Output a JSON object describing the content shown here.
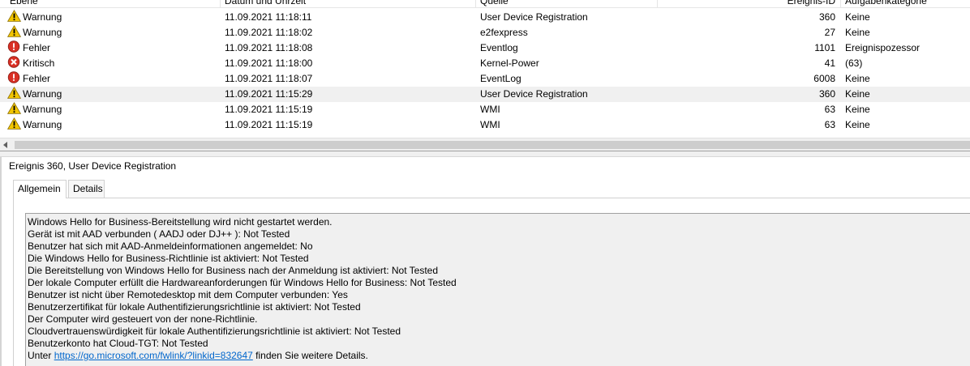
{
  "columns": {
    "level": "Ebene",
    "datetime": "Datum und Uhrzeit",
    "source": "Quelle",
    "event_id": "Ereignis-ID",
    "category": "Aufgabenkategorie"
  },
  "events": [
    {
      "level": "Warnung",
      "icon": "warning-icon",
      "datetime": "11.09.2021 11:18:11",
      "source": "User Device Registration",
      "event_id": "360",
      "category": "Keine"
    },
    {
      "level": "Warnung",
      "icon": "warning-icon",
      "datetime": "11.09.2021 11:18:02",
      "source": "e2fexpress",
      "event_id": "27",
      "category": "Keine"
    },
    {
      "level": "Fehler",
      "icon": "error-icon",
      "datetime": "11.09.2021 11:18:08",
      "source": "Eventlog",
      "event_id": "1101",
      "category": "Ereignispozessor"
    },
    {
      "level": "Kritisch",
      "icon": "critical-icon",
      "datetime": "11.09.2021 11:18:00",
      "source": "Kernel-Power",
      "event_id": "41",
      "category": "(63)"
    },
    {
      "level": "Fehler",
      "icon": "error-icon",
      "datetime": "11.09.2021 11:18:07",
      "source": "EventLog",
      "event_id": "6008",
      "category": "Keine"
    },
    {
      "level": "Warnung",
      "icon": "warning-icon",
      "datetime": "11.09.2021 11:15:29",
      "source": "User Device Registration",
      "event_id": "360",
      "category": "Keine",
      "selected": true
    },
    {
      "level": "Warnung",
      "icon": "warning-icon",
      "datetime": "11.09.2021 11:15:19",
      "source": "WMI",
      "event_id": "63",
      "category": "Keine"
    },
    {
      "level": "Warnung",
      "icon": "warning-icon",
      "datetime": "11.09.2021 11:15:19",
      "source": "WMI",
      "event_id": "63",
      "category": "Keine"
    }
  ],
  "detail": {
    "title": "Ereignis 360, User Device Registration",
    "tabs": [
      "Allgemein",
      "Details"
    ],
    "lines": [
      "Windows Hello for Business-Bereitstellung wird nicht gestartet werden.",
      "Gerät ist mit AAD verbunden ( AADJ oder DJ++ ): Not Tested",
      "Benutzer hat sich mit AAD-Anmeldeinformationen angemeldet: No",
      "Die Windows Hello for Business-Richtlinie ist aktiviert: Not Tested",
      "Die Bereitstellung von Windows Hello for Business nach der Anmeldung ist aktiviert: Not Tested",
      "Der lokale Computer erfüllt die Hardwareanforderungen für Windows Hello for Business: Not Tested",
      "Benutzer ist nicht über Remotedesktop mit dem Computer verbunden: Yes",
      "Benutzerzertifikat für lokale Authentifizierungsrichtlinie ist aktiviert: Not Tested",
      "Der Computer wird gesteuert von der none-Richtlinie.",
      "Cloudvertrauenswürdigkeit für lokale Authentifizierungsrichtlinie ist aktiviert: Not Tested",
      "Benutzerkonto hat Cloud-TGT: Not Tested"
    ],
    "link_prefix": "Unter ",
    "link_text": "https://go.microsoft.com/fwlink/?linkid=832647",
    "link_suffix": " finden Sie weitere Details."
  },
  "colors": {
    "warning": "#f2c500",
    "error": "#d93025",
    "link": "#0066cc",
    "selected_row": "#f0f0f0"
  }
}
